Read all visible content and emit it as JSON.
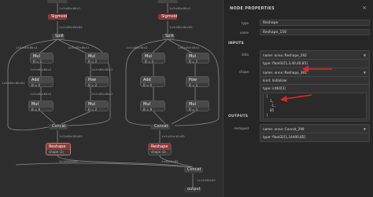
{
  "graph": {
    "top_edge": "1×3×80×80×2",
    "sigmoid": "Sigmoid",
    "e_sig_split": "1×3×80×80×85",
    "split": "Split",
    "left": {
      "mul1": {
        "title": "Mul",
        "row": "B = 2"
      },
      "mul2": {
        "title": "Mul",
        "row": "B = 2"
      },
      "add": {
        "title": "Add",
        "row": "B = 0"
      },
      "pow": {
        "title": "Pow",
        "row": "B = 2"
      },
      "mul3": {
        "title": "Mul",
        "row": "B = 8"
      },
      "mul4": {
        "title": "Mul",
        "row": "B = 2"
      },
      "concat": "Concat"
    },
    "right": {
      "mul1": {
        "title": "Mul",
        "row": "B = 2"
      },
      "mul2": {
        "title": "Mul",
        "row": "B = 2"
      },
      "add": {
        "title": "Add",
        "row": "B = 0"
      },
      "pow": {
        "title": "Pow",
        "row": "B = 2"
      },
      "mul3": {
        "title": "Mul",
        "row": "B = 8"
      },
      "mul4": {
        "title": "Mul",
        "row": "B = 2"
      },
      "concat": "Concat"
    },
    "reshape_left": {
      "title": "Reshape",
      "row": "shape ⟨3⟩"
    },
    "reshape_right": {
      "title": "Reshape",
      "row": "shape ⟨3⟩"
    },
    "final_concat": "Concat",
    "output": "output",
    "e_a": "1×3×80×80×2",
    "e_b": "1×3×80×80×2",
    "e_c": "1×3×80×80×81",
    "e_d": "1×3×80×80×85",
    "e_e": "1×19200×85",
    "e_f": "1×4800×85",
    "e_g": "1×14400×85",
    "e_h": "1×3×40×40×2",
    "e_i": "1×3×40×40×85"
  },
  "panel": {
    "title": "NODE PROPERTIES",
    "close": "×",
    "type_label": "type",
    "type_value": "Reshape",
    "name_label": "name",
    "name_value": "Reshape_156",
    "inputs_heading": "INPUTS",
    "data_label": "data",
    "data_name": "name: onnx::Reshape_292",
    "data_type": "type: float32[1,3,40,40,85]",
    "shape_label": "shape",
    "shape_name": "name: onnx::Reshape_391",
    "shape_kind": "kind: Initializer",
    "shape_type": "type: int64[3]",
    "shape_code": [
      "[",
      "  1,",
      "  -1,",
      "  85",
      "]"
    ],
    "outputs_heading": "OUTPUTS",
    "reshaped_label": "reshaped",
    "out_name": "name: onnx::Concat_299",
    "out_type": "type: float32[1,14400,85]",
    "accent": "#e02424"
  }
}
